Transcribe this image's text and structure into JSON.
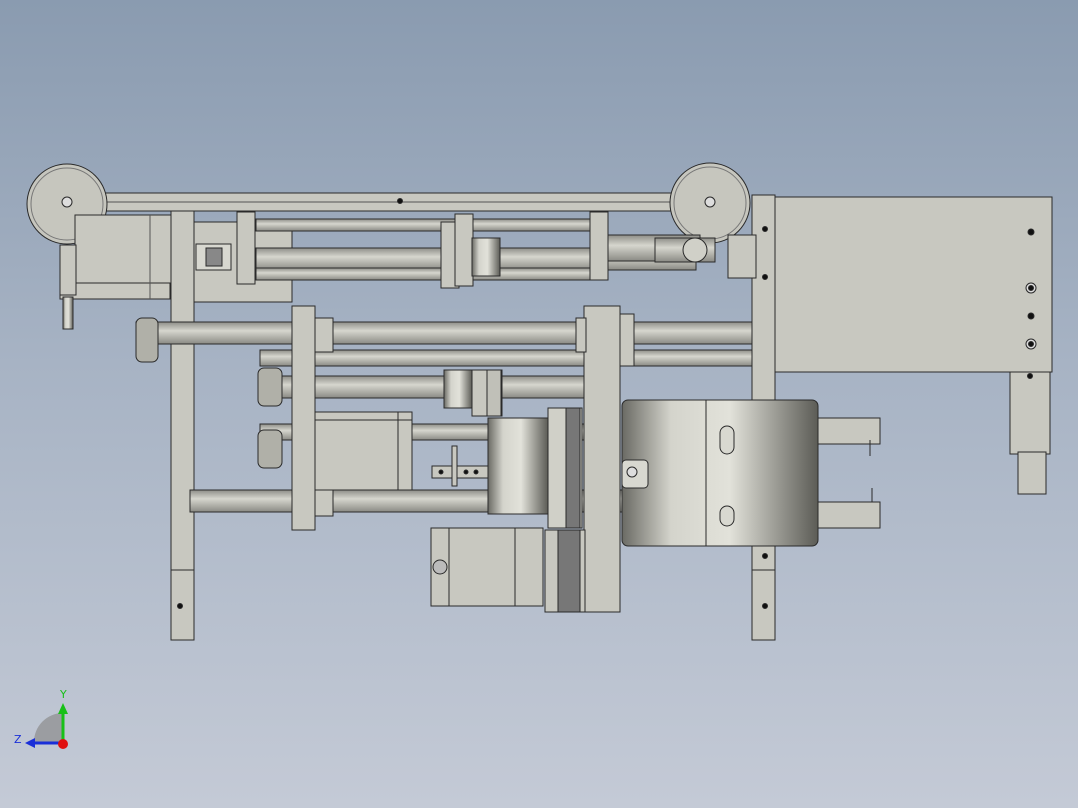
{
  "view": {
    "background_top": "#8a9bb0",
    "background_bottom": "#c4cad6",
    "part_fill": "#c8c8c0",
    "part_stroke": "#2a2a2a",
    "rod_fill": "#b9b9b1"
  },
  "triad": {
    "y_label": "Y",
    "z_label": "Z",
    "y_color": "#18c018",
    "z_color": "#1a2fd8",
    "x_color": "#e01010"
  }
}
